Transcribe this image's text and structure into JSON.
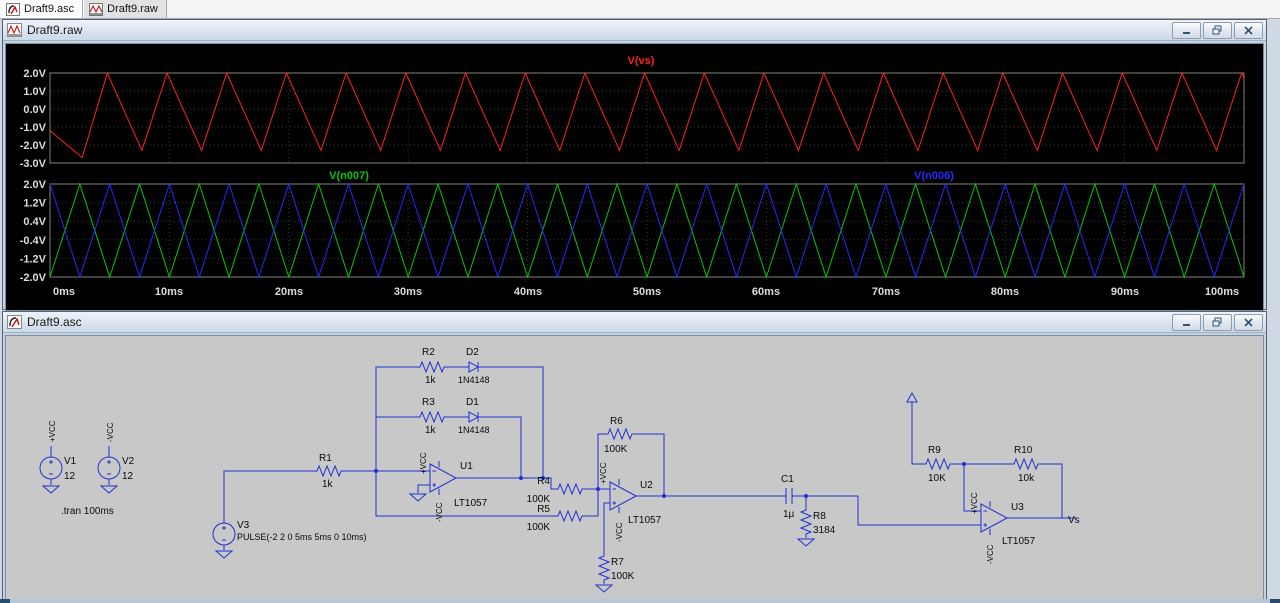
{
  "tabs": [
    {
      "label": "Draft9.asc",
      "icon": "ltspice-schematic-icon",
      "active": true
    },
    {
      "label": "Draft9.raw",
      "icon": "waveform-file-icon",
      "active": false
    }
  ],
  "wave_window": {
    "title": "Draft9.raw",
    "controls": {
      "minimize": "minimize-icon",
      "restore": "restore-icon",
      "close": "close-icon"
    }
  },
  "schematic_window": {
    "title": "Draft9.asc",
    "controls": {
      "minimize": "minimize-icon",
      "restore": "restore-icon",
      "close": "close-icon"
    }
  },
  "chart_data": {
    "type": "line",
    "x_range_ms": [
      0,
      100
    ],
    "x_ticks": [
      "0ms",
      "10ms",
      "20ms",
      "30ms",
      "40ms",
      "50ms",
      "60ms",
      "70ms",
      "80ms",
      "90ms",
      "100ms"
    ],
    "grid": true,
    "background": "#000000",
    "panes": [
      {
        "y_ticks": [
          "2.0V",
          "1.0V",
          "0.0V",
          "-1.0V",
          "-2.0V",
          "-3.0V"
        ],
        "y_range": [
          -3.0,
          2.0
        ],
        "series": [
          {
            "name": "V(vs)",
            "color": "#ff2020",
            "waveform": "triangle",
            "period_ms": 5,
            "v_max": 2.0,
            "v_min": -2.3,
            "peaks_ms_start": 4.8,
            "valleys_ms_start": 7.7,
            "initial_points": [
              [
                0,
                -1.2
              ],
              [
                2.7,
                -2.7
              ]
            ],
            "final_points": [
              [
                100,
                1.7
              ]
            ],
            "label_x_ms": 49.5
          }
        ]
      },
      {
        "y_ticks": [
          "2.0V",
          "1.2V",
          "0.4V",
          "-0.4V",
          "-1.2V",
          "-2.0V"
        ],
        "y_range": [
          -2.0,
          2.0
        ],
        "series": [
          {
            "name": "V(n007)",
            "color": "#00c800",
            "waveform": "triangle",
            "period_ms": 5,
            "v_max": 2.0,
            "v_min": -2.0,
            "peaks_ms_start": 2.5,
            "valleys_ms_start": 0,
            "initial_points": [],
            "final_points": [],
            "label_x_ms": 25
          },
          {
            "name": "V(n006)",
            "color": "#2828ff",
            "waveform": "triangle",
            "period_ms": 5,
            "v_max": 2.0,
            "v_min": -2.0,
            "peaks_ms_start": 0,
            "valleys_ms_start": 2.5,
            "initial_points": [],
            "final_points": [],
            "label_x_ms": 74
          }
        ]
      }
    ]
  },
  "schematic": {
    "directive": ".tran 100ms",
    "v1": {
      "name": "V1",
      "value": "12",
      "flag": "+VCC"
    },
    "v2": {
      "name": "V2",
      "value": "12",
      "flag": "-VCC"
    },
    "v3": {
      "name": "V3",
      "value": "PULSE(-2 2 0 5ms 5ms 0 10ms)"
    },
    "r1": {
      "name": "R1",
      "value": "1k"
    },
    "r2": {
      "name": "R2",
      "value": "1k"
    },
    "r3": {
      "name": "R3",
      "value": "1k"
    },
    "r4": {
      "name": "R4",
      "value": "100K"
    },
    "r5": {
      "name": "R5",
      "value": "100K"
    },
    "r6": {
      "name": "R6",
      "value": "100K"
    },
    "r7": {
      "name": "R7",
      "value": "100K"
    },
    "r8": {
      "name": "R8",
      "value": "3184"
    },
    "r9": {
      "name": "R9",
      "value": "10K"
    },
    "r10": {
      "name": "R10",
      "value": "10k"
    },
    "d1": {
      "name": "D1",
      "value": "1N4148"
    },
    "d2": {
      "name": "D2",
      "value": "1N4148"
    },
    "u1": {
      "name": "U1",
      "value": "LT1057",
      "rail_pos": "+VCC",
      "rail_neg": "-VCC"
    },
    "u2": {
      "name": "U2",
      "value": "LT1057",
      "rail_pos": "+VCC",
      "rail_neg": "-VCC"
    },
    "u3": {
      "name": "U3",
      "value": "LT1057",
      "rail_pos": "+VCC",
      "rail_neg": "-VCC"
    },
    "c1": {
      "name": "C1",
      "value": "1µ"
    },
    "out_label": "Vs"
  }
}
